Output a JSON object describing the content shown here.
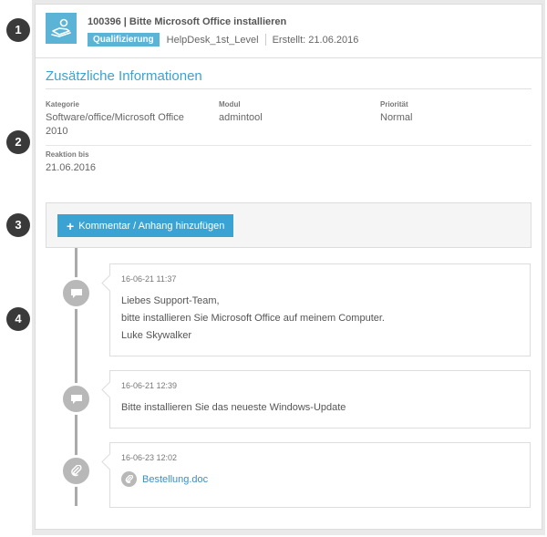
{
  "markers": [
    "1",
    "2",
    "3",
    "4"
  ],
  "ticket": {
    "title": "100396 | Bitte Microsoft Office installieren",
    "badge": "Qualifizierung",
    "queue": "HelpDesk_1st_Level",
    "created": "Erstellt: 21.06.2016",
    "icon": "ticket-hand-icon"
  },
  "info": {
    "title": "Zusätzliche Informationen",
    "kategorie_label": "Kategorie",
    "kategorie_line1": "Software/office/Microsoft Office",
    "kategorie_line2": "2010",
    "modul_label": "Modul",
    "modul_value": "admintool",
    "prioritaet_label": "Priorität",
    "prioritaet_value": "Normal",
    "reaktion_label": "Reaktion bis",
    "reaktion_value": "21.06.2016"
  },
  "actions": {
    "add_label": "Kommentar / Anhang hinzufügen"
  },
  "timeline": [
    {
      "time": "16-06-21 11:37",
      "icon": "comment-icon",
      "lines": [
        "Liebes Support-Team,",
        "bitte installieren Sie Microsoft Office auf meinem Computer.",
        "Luke Skywalker"
      ]
    },
    {
      "time": "16-06-21 12:39",
      "icon": "comment-icon",
      "lines": [
        "Bitte installieren Sie das neueste Windows-Update"
      ]
    },
    {
      "time": "16-06-23 12:02",
      "icon": "paperclip-icon",
      "attachment": "Bestellung.doc"
    }
  ],
  "colors": {
    "accent": "#3aa3d4",
    "badge": "#5bb3d6",
    "marker": "#3a3a3a",
    "timeline_icon": "#b8b8b8"
  }
}
